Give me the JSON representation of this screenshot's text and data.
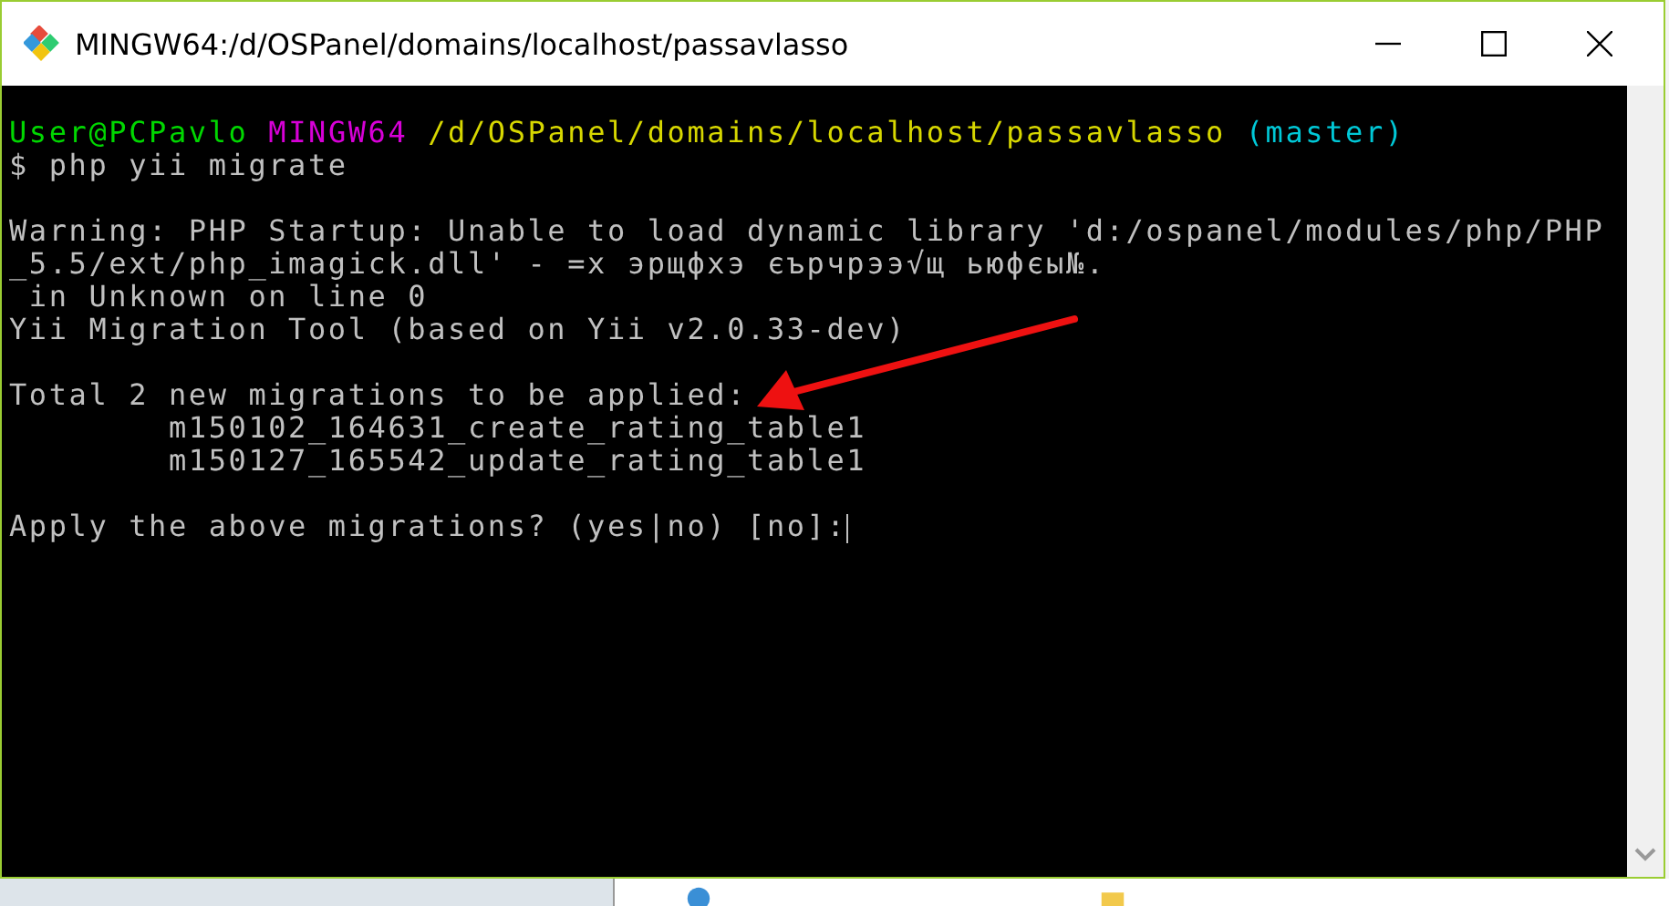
{
  "window": {
    "title": "MINGW64:/d/OSPanel/domains/localhost/passavlasso"
  },
  "terminal": {
    "lines": [
      {
        "kind": "prompt",
        "segments": [
          {
            "text": "User@PCPavlo",
            "color": "#00d700"
          },
          {
            "text": "MINGW64",
            "color": "#d700d7"
          },
          {
            "text": "/d/OSPanel/domains/localhost/passavlasso",
            "color": "#d7d700"
          },
          {
            "text": "(master)",
            "color": "#00c8d7"
          }
        ]
      },
      {
        "kind": "output",
        "text": "$ php yii migrate"
      },
      {
        "kind": "blank"
      },
      {
        "kind": "output",
        "text": "Warning: PHP Startup: Unable to load dynamic library 'd:/ospanel/modules/php/PHP"
      },
      {
        "kind": "output",
        "text": "_5.5/ext/php_imagick.dll' - =х эрщфхэ єърчрээ√щ ьюфєы№."
      },
      {
        "kind": "output",
        "text": " in Unknown on line 0"
      },
      {
        "kind": "output",
        "text": "Yii Migration Tool (based on Yii v2.0.33-dev)"
      },
      {
        "kind": "blank"
      },
      {
        "kind": "output",
        "text": "Total 2 new migrations to be applied:"
      },
      {
        "kind": "output",
        "text": "        m150102_164631_create_rating_table1"
      },
      {
        "kind": "output",
        "text": "        m150127_165542_update_rating_table1"
      },
      {
        "kind": "blank"
      },
      {
        "kind": "input",
        "text": "Apply the above migrations? (yes|no) [no]:",
        "cursor": true
      }
    ]
  }
}
